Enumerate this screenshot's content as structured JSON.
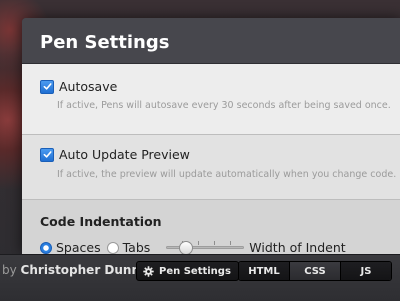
{
  "modal": {
    "title": "Pen Settings",
    "autosave": {
      "label": "Autosave",
      "checked": true,
      "hint": "If active, Pens will autosave every 30 seconds after being saved once."
    },
    "auto_update": {
      "label": "Auto Update Preview",
      "checked": true,
      "hint": "If active, the preview will update automatically when you change code."
    },
    "indentation": {
      "title": "Code Indentation",
      "options": [
        "Spaces",
        "Tabs"
      ],
      "selected": "Spaces",
      "width_label": "Width of Indent",
      "width_level_fraction": 0.2
    }
  },
  "footer": {
    "by_prefix": "by",
    "author": "Christopher Dunn",
    "settings_button": "Pen Settings",
    "settings_icon": "gear-icon",
    "tabs": [
      "HTML",
      "CSS",
      "JS"
    ],
    "active_tab": "CSS"
  },
  "colors": {
    "accent": "#2a7fe0",
    "modal_bg": "#3f3f44",
    "footer_bg": "#2e2e32"
  }
}
